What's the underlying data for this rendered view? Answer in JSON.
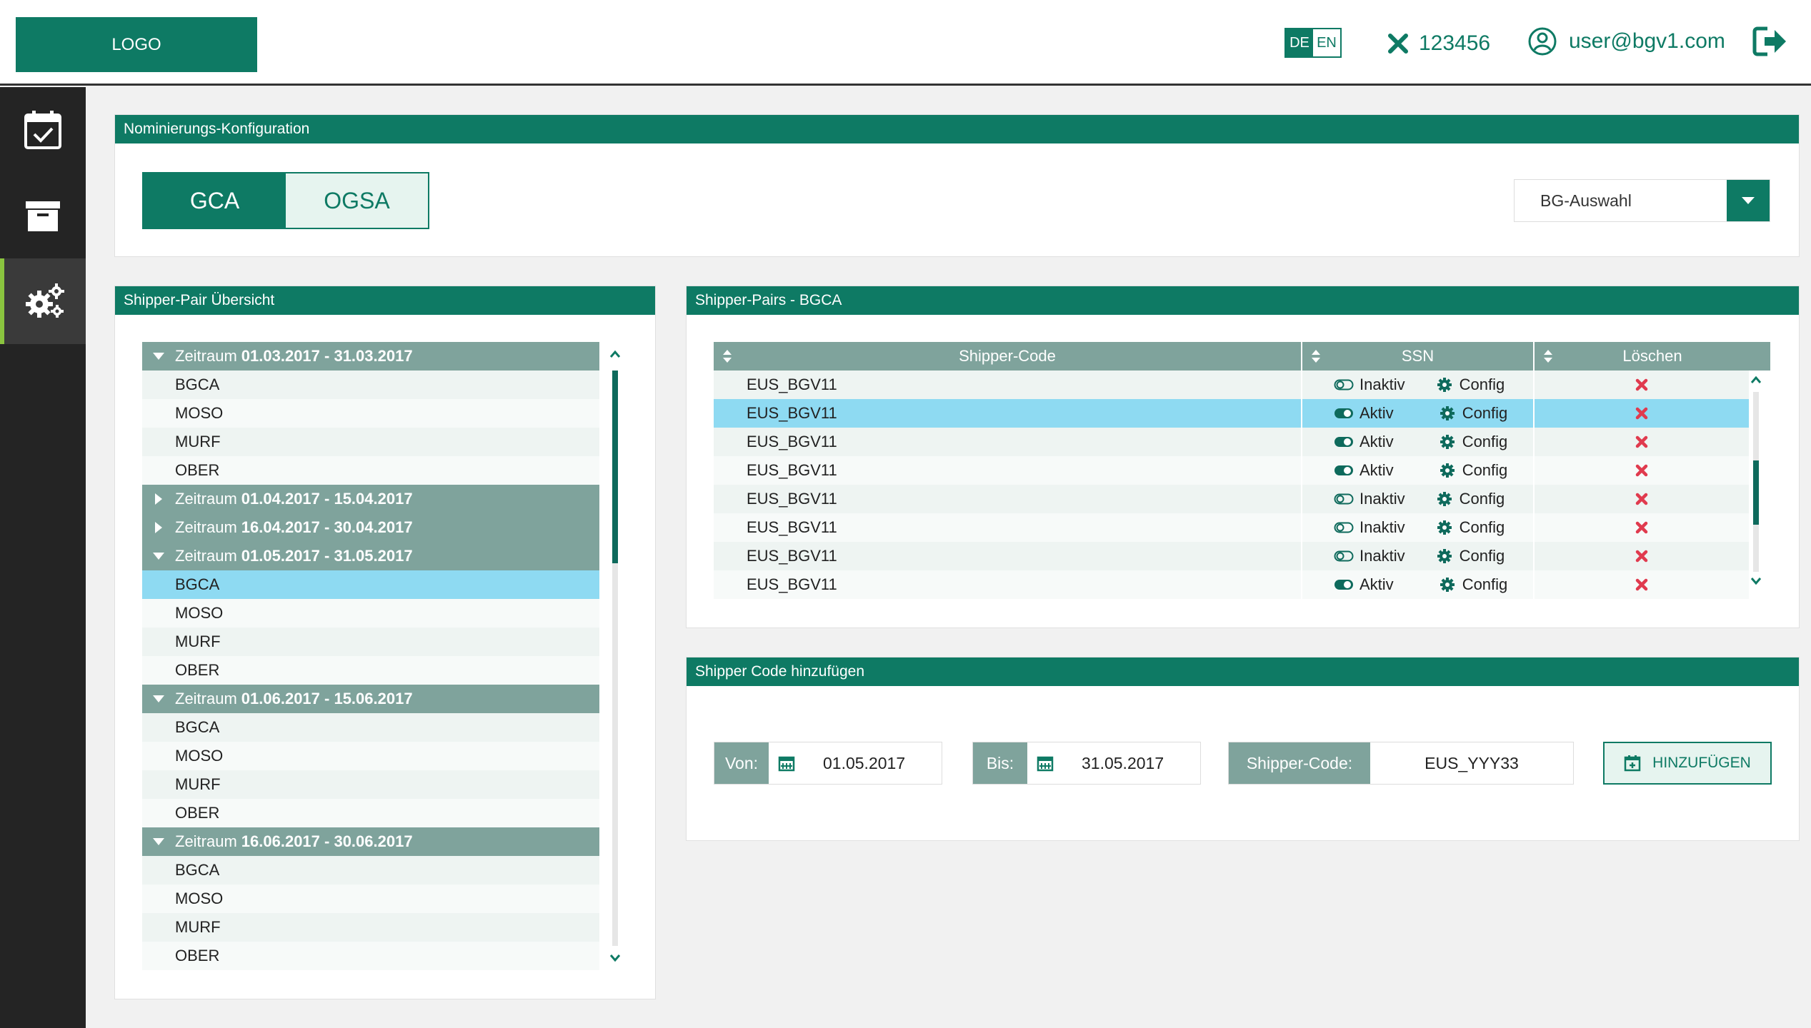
{
  "header": {
    "logo": "LOGO",
    "lang": {
      "active": "DE",
      "inactive": "EN"
    },
    "id_number": "123456",
    "user": "user@bgv1.com"
  },
  "sidebar": {
    "items": [
      "calendar-check",
      "archive",
      "settings"
    ]
  },
  "config": {
    "title": "Nominierungs-Konfiguration",
    "tabs": [
      "GCA",
      "OGSA"
    ],
    "select_label": "BG-Auswahl"
  },
  "overview": {
    "title": "Shipper-Pair Übersicht",
    "prefix": "Zeitraum",
    "groups": [
      {
        "period": "01.03.2017 - 31.03.2017",
        "expanded": true,
        "items": [
          "BGCA",
          "MOSO",
          "MURF",
          "OBER"
        ]
      },
      {
        "period": "01.04.2017 - 15.04.2017",
        "expanded": false,
        "items": []
      },
      {
        "period": "16.04.2017 - 30.04.2017",
        "expanded": false,
        "items": []
      },
      {
        "period": "01.05.2017 - 31.05.2017",
        "expanded": true,
        "items": [
          "BGCA",
          "MOSO",
          "MURF",
          "OBER"
        ]
      },
      {
        "period": "01.06.2017 - 15.06.2017",
        "expanded": true,
        "items": [
          "BGCA",
          "MOSO",
          "MURF",
          "OBER"
        ]
      },
      {
        "period": "16.06.2017 - 30.06.2017",
        "expanded": true,
        "items": [
          "BGCA",
          "MOSO",
          "MURF",
          "OBER"
        ]
      }
    ]
  },
  "pairs": {
    "title": "Shipper-Pairs - BGCA",
    "columns": [
      "Shipper-Code",
      "SSN",
      "Löschen"
    ],
    "config_label": "Config",
    "rows": [
      {
        "code": "EUS_BGV11",
        "status": "Inaktiv"
      },
      {
        "code": "EUS_BGV11",
        "status": "Aktiv"
      },
      {
        "code": "EUS_BGV11",
        "status": "Aktiv"
      },
      {
        "code": "EUS_BGV11",
        "status": "Aktiv"
      },
      {
        "code": "EUS_BGV11",
        "status": "Inaktiv"
      },
      {
        "code": "EUS_BGV11",
        "status": "Inaktiv"
      },
      {
        "code": "EUS_BGV11",
        "status": "Inaktiv"
      },
      {
        "code": "EUS_BGV11",
        "status": "Aktiv"
      }
    ]
  },
  "add": {
    "title": "Shipper Code hinzufügen",
    "von_label": "Von:",
    "von_value": "01.05.2017",
    "bis_label": "Bis:",
    "bis_value": "31.05.2017",
    "code_label": "Shipper-Code:",
    "code_value": "EUS_YYY33",
    "button": "HINZUFÜGEN"
  },
  "colors": {
    "brand": "#0e7a64",
    "group": "#7fa39c",
    "selected": "#8edaf2",
    "delete": "#e03a4e",
    "sidebar": "#242424",
    "accent": "#8ac43f"
  }
}
